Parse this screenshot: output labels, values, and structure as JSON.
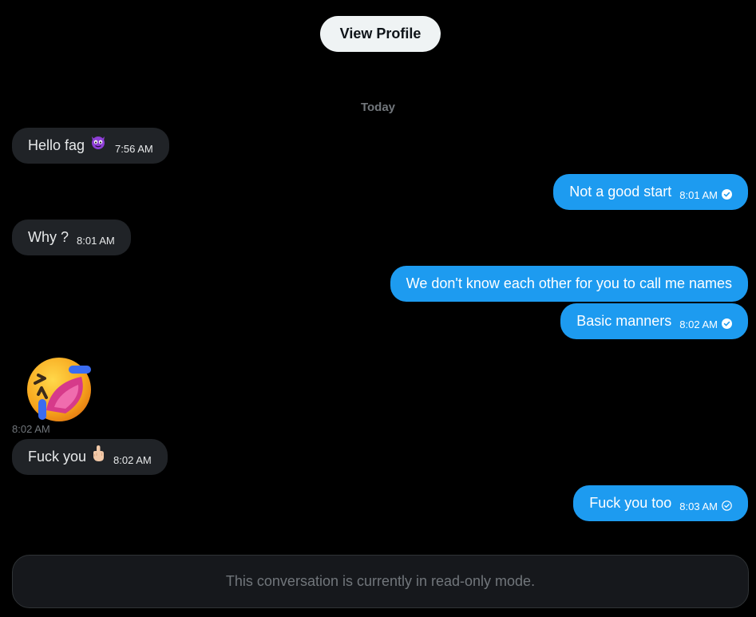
{
  "header": {
    "view_profile_label": "View Profile"
  },
  "conversation": {
    "day_separator": "Today",
    "messages": [
      {
        "direction": "received",
        "text": "Hello fag",
        "emoji": "smiling-devil-emoji",
        "time": "7:56 AM"
      },
      {
        "direction": "sent",
        "text": "Not a good start",
        "time": "8:01 AM",
        "status": "read"
      },
      {
        "direction": "received",
        "text": "Why ?",
        "time": "8:01 AM"
      },
      {
        "direction": "sent",
        "text": "We don't know each other for you to call me names"
      },
      {
        "direction": "sent",
        "text": "Basic manners",
        "time": "8:02 AM",
        "status": "read"
      },
      {
        "direction": "received",
        "type": "sticker",
        "sticker": "rolling-on-floor-laughing-emoji",
        "time": "8:02 AM"
      },
      {
        "direction": "received",
        "text": "Fuck you",
        "emoji": "middle-finger-emoji",
        "time": "8:02 AM"
      },
      {
        "direction": "sent",
        "text": "Fuck you too",
        "time": "8:03 AM",
        "status": "sent"
      }
    ]
  },
  "footer": {
    "readonly_notice": "This conversation is currently in read-only mode."
  },
  "colors": {
    "background": "#000000",
    "sent_bubble": "#1d9bf0",
    "received_bubble": "#202327",
    "muted_text": "#71767b",
    "profile_button": "#eff3f4"
  }
}
